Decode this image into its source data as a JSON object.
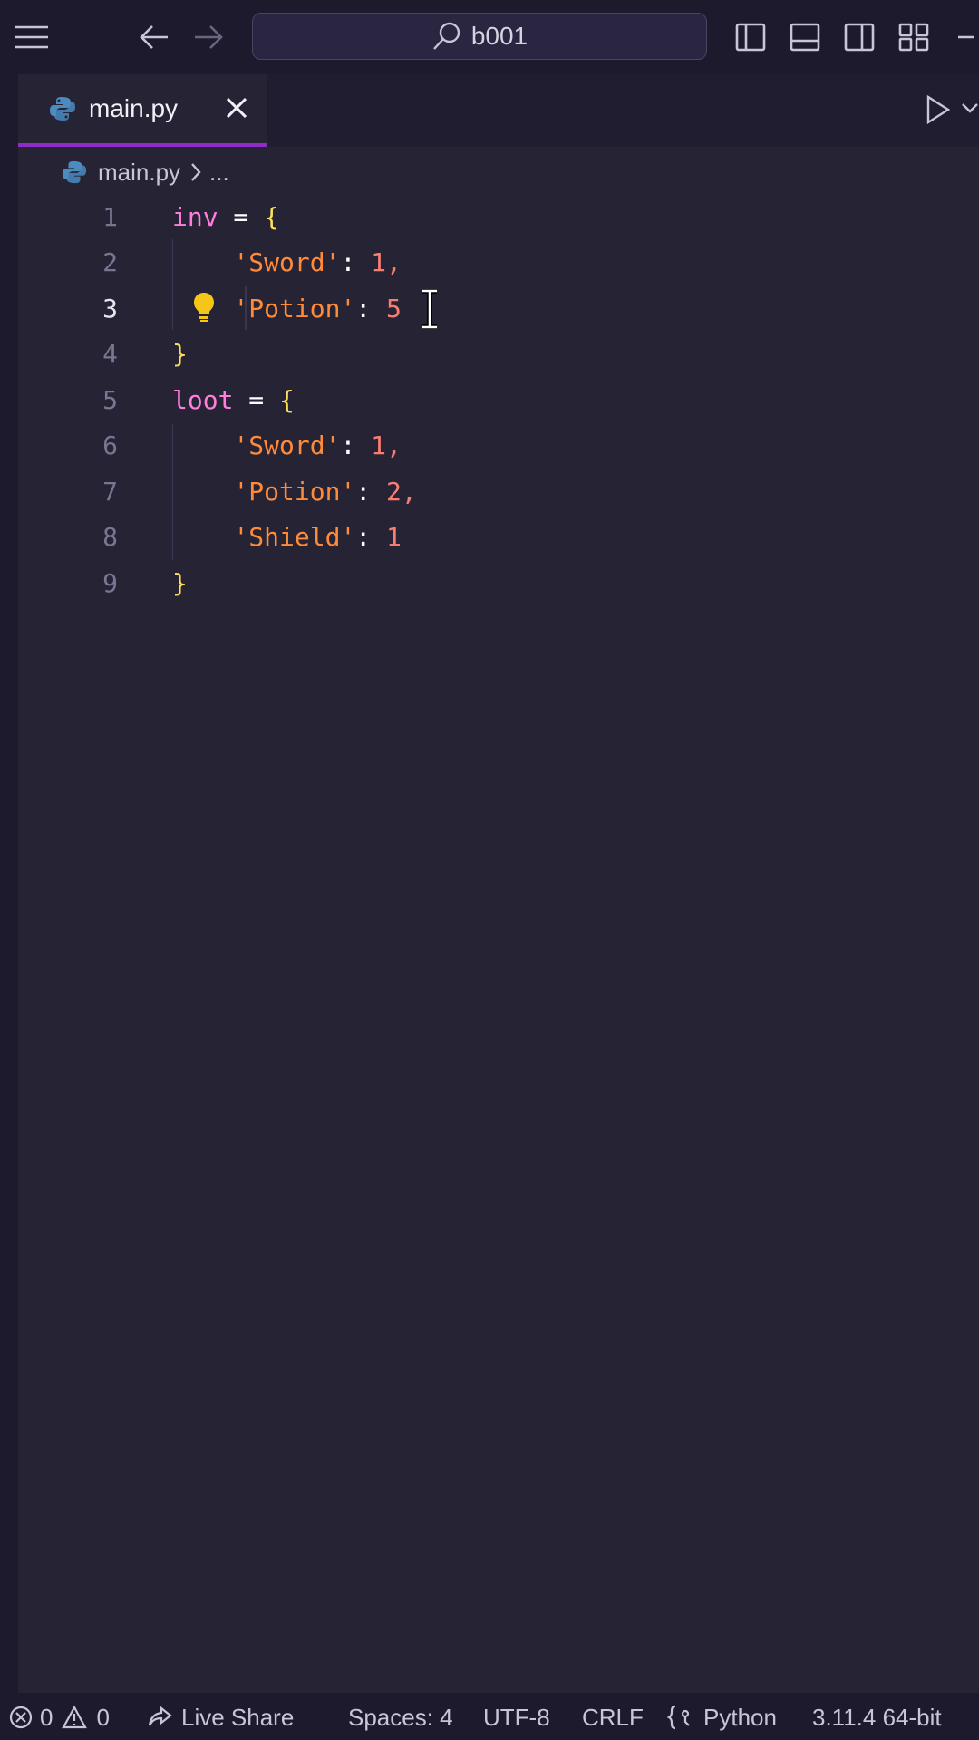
{
  "titlebar": {
    "search_text": "b001"
  },
  "tabs": [
    {
      "label": "main.py",
      "icon": "python-icon",
      "active": true
    }
  ],
  "breadcrumb": {
    "file": "main.py",
    "ellipsis": "..."
  },
  "editor": {
    "lines": [
      {
        "num": "1",
        "indent": "",
        "tokens": [
          [
            "kw",
            "inv"
          ],
          [
            "op",
            " = "
          ],
          [
            "br",
            "{"
          ]
        ]
      },
      {
        "num": "2",
        "indent": "    ",
        "tokens": [
          [
            "str",
            "'Sword'"
          ],
          [
            "op",
            ": "
          ],
          [
            "num",
            "1,"
          ]
        ]
      },
      {
        "num": "3",
        "indent": "    ",
        "tokens": [
          [
            "str",
            "'Potion'"
          ],
          [
            "op",
            ": "
          ],
          [
            "num",
            "5"
          ]
        ]
      },
      {
        "num": "4",
        "indent": "",
        "tokens": [
          [
            "br",
            "}"
          ]
        ]
      },
      {
        "num": "5",
        "indent": "",
        "tokens": [
          [
            "kw",
            "loot"
          ],
          [
            "op",
            " = "
          ],
          [
            "br",
            "{"
          ]
        ]
      },
      {
        "num": "6",
        "indent": "    ",
        "tokens": [
          [
            "str",
            "'Sword'"
          ],
          [
            "op",
            ": "
          ],
          [
            "num",
            "1,"
          ]
        ]
      },
      {
        "num": "7",
        "indent": "    ",
        "tokens": [
          [
            "str",
            "'Potion'"
          ],
          [
            "op",
            ": "
          ],
          [
            "num",
            "2,"
          ]
        ]
      },
      {
        "num": "8",
        "indent": "    ",
        "tokens": [
          [
            "str",
            "'Shield'"
          ],
          [
            "op",
            ": "
          ],
          [
            "num",
            "1"
          ]
        ]
      },
      {
        "num": "9",
        "indent": "",
        "tokens": [
          [
            "br",
            "}"
          ]
        ]
      }
    ],
    "active_line": "3"
  },
  "statusbar": {
    "errors": "0",
    "warnings": "0",
    "live_share": "Live Share",
    "spaces": "Spaces: 4",
    "encoding": "UTF-8",
    "eol": "CRLF",
    "language": "Python",
    "interpreter": "3.11.4 64-bit"
  },
  "colors": {
    "background": "#262335",
    "keyword": "#ff7edb",
    "string": "#ff8b39",
    "number": "#f97e72",
    "bracket": "#fede5d",
    "tab_accent": "#8e2dc5"
  }
}
